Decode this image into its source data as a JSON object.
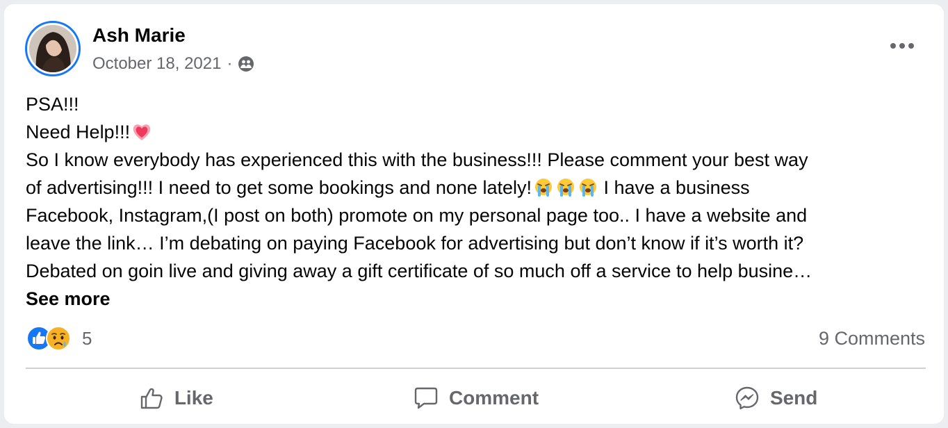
{
  "post": {
    "author": "Ash Marie",
    "date": "October 18, 2021",
    "separator": "·",
    "privacy_icon": "friends-icon",
    "menu_icon": "more-options-icon",
    "lines": [
      "PSA!!!",
      "Need Help!!!",
      "So I know everybody has experienced this with the business!!! Please comment your best way",
      "of advertising!!! I need to get some bookings and none lately!",
      " I have a business",
      "Facebook, Instagram,(I post on both) promote on my personal page too.. I have a website and",
      "leave the link… I’m debating on paying Facebook for advertising but don’t know if it’s worth it?",
      "Debated on goin live and giving away a gift certificate of so much off a service to help busine…"
    ],
    "see_more": "See more"
  },
  "reactions": {
    "icons": [
      "like-icon",
      "sad-icon"
    ],
    "count": "5",
    "comments": "9 Comments"
  },
  "actions": {
    "like": "Like",
    "comment": "Comment",
    "send": "Send"
  },
  "colors": {
    "brand_blue": "#1877f2",
    "muted_text": "#65676b",
    "divider": "#ced0d4"
  }
}
